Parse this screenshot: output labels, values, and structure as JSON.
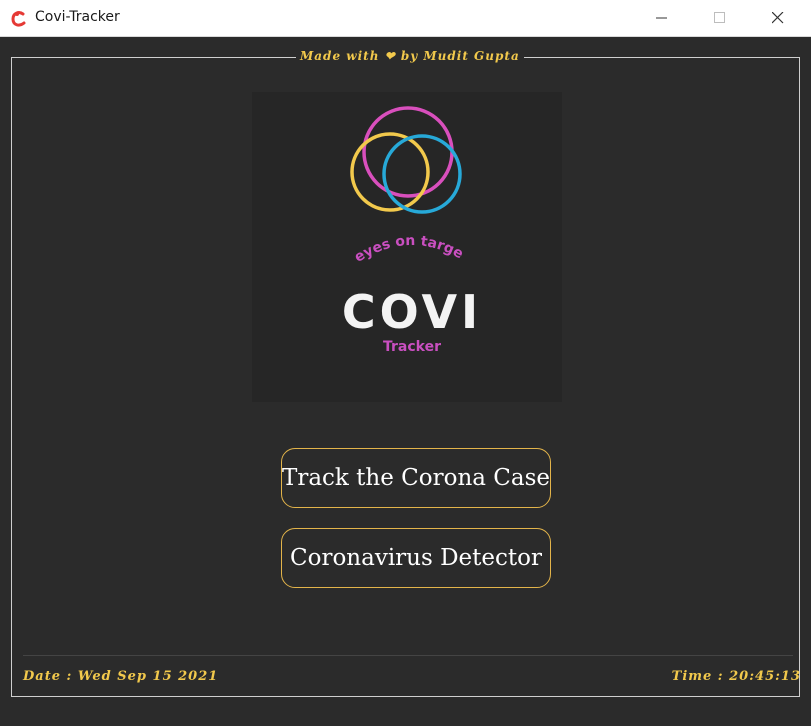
{
  "window": {
    "title": "Covi-Tracker",
    "icon": "app-logo-icon",
    "controls": [
      "minimize-icon",
      "maximize-icon",
      "close-icon"
    ]
  },
  "frame": {
    "label": "Made with ❤ by Mudit Gupta"
  },
  "logo": {
    "tagline": "eyes on target",
    "title": "COVI",
    "subtitle": "Tracker",
    "ring_colors": [
      "#d94fbd",
      "#f2c94c",
      "#27a9d8"
    ]
  },
  "buttons": {
    "track_label": "Track the Corona Case",
    "detector_label": "Coronavirus Detector"
  },
  "footer": {
    "date": "Date : Wed Sep 15 2021",
    "time": "Time : 20:45:13"
  },
  "colors": {
    "background": "#2b2b2b",
    "accent_yellow": "#f2c94c",
    "button_border": "#e3b44a",
    "magenta": "#c94fc0"
  }
}
